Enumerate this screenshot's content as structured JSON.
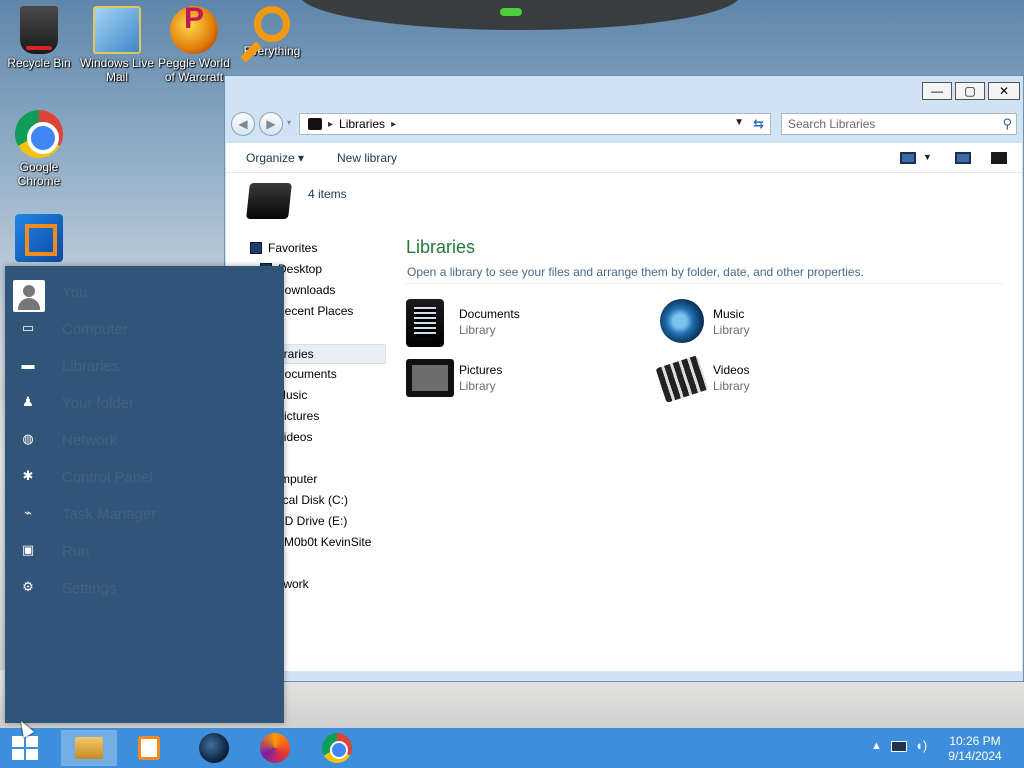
{
  "desktop": {
    "icons": [
      {
        "label": "Recycle Bin",
        "icon": "recycle-bin-icon"
      },
      {
        "label": "Windows Live Mail",
        "icon": "mail-icon"
      },
      {
        "label": "Peggle World of Warcraft",
        "icon": "peggle-icon"
      },
      {
        "label": "Everything",
        "icon": "search-magnifier-icon"
      },
      {
        "label": "Google Chrome",
        "icon": "chrome-icon"
      },
      {
        "label": "",
        "icon": "vmware-icon"
      }
    ]
  },
  "window": {
    "controls": {
      "minimize": "—",
      "maximize": "▢",
      "close": "✕"
    },
    "address": {
      "path": "Libraries"
    },
    "search": {
      "placeholder": "Search Libraries"
    },
    "toolbar": {
      "organize": "Organize ▾",
      "new_library": "New library"
    },
    "item_count": "4 items",
    "nav": {
      "favorites": "Favorites",
      "desktop": "Desktop",
      "downloads": "Downloads",
      "recent": "Recent Places",
      "libraries": "braries",
      "documents": "Documents",
      "music": "Music",
      "pictures": "Pictures",
      "videos": "Videos",
      "computer": "mputer",
      "local_disk": "ocal Disk (C:)",
      "cd_drive": "CD Drive (E:)",
      "share": "VM0b0t KevinSite",
      "network": "twork"
    },
    "main": {
      "title": "Libraries",
      "subtitle": "Open a library to see your files and arrange them by folder, date, and other properties.",
      "libraries": [
        {
          "name": "Documents",
          "type": "Library",
          "icon": "documents-library-icon"
        },
        {
          "name": "Music",
          "type": "Library",
          "icon": "music-library-icon"
        },
        {
          "name": "Pictures",
          "type": "Library",
          "icon": "pictures-library-icon"
        },
        {
          "name": "Videos",
          "type": "Library",
          "icon": "videos-library-icon"
        }
      ]
    }
  },
  "start_menu": {
    "items": [
      {
        "label": "You",
        "icon": "user-avatar-icon"
      },
      {
        "label": "Computer",
        "icon": "monitor-icon"
      },
      {
        "label": "Libraries",
        "icon": "folder-icon"
      },
      {
        "label": "Your folder",
        "icon": "user-folder-icon"
      },
      {
        "label": "Network",
        "icon": "network-icon"
      },
      {
        "label": "Control Panel",
        "icon": "control-panel-icon"
      },
      {
        "label": "Task Manager",
        "icon": "task-manager-icon"
      },
      {
        "label": "Run",
        "icon": "run-icon"
      },
      {
        "label": "Settings",
        "icon": "settings-gear-icon"
      }
    ]
  },
  "taskbar": {
    "apps": [
      "File Explorer",
      "Media Player",
      "Game",
      "Firefox",
      "Google Chrome"
    ],
    "clock": {
      "time": "10:26 PM",
      "date": "9/14/2024"
    }
  }
}
